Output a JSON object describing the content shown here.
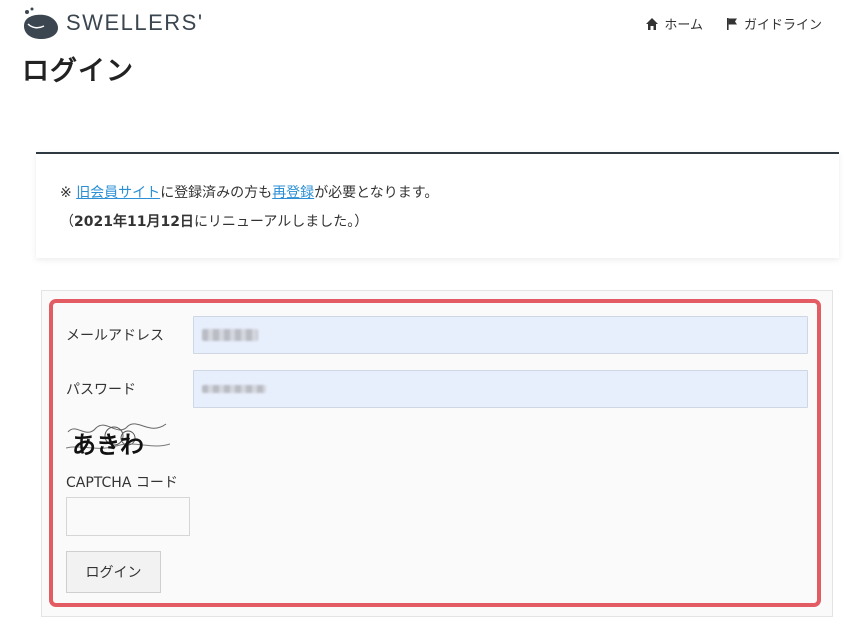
{
  "header": {
    "logo_text": "SWELLERS'",
    "nav": [
      {
        "label": "ホーム",
        "icon": "home-icon"
      },
      {
        "label": "ガイドライン",
        "icon": "flag-icon"
      }
    ]
  },
  "page": {
    "title": "ログイン"
  },
  "notice": {
    "prefix": "※ ",
    "link1": "旧会員サイト",
    "mid1": "に登録済みの方も",
    "link2": "再登録",
    "suffix": "が必要となります。",
    "line2_open": "（",
    "line2_date": "2021年11月12日",
    "line2_rest": "にリニューアルしました。）"
  },
  "form": {
    "email_label": "メールアドレス",
    "password_label": "パスワード",
    "captcha_text": "あきわ",
    "captcha_code_label": "CAPTCHA コード",
    "login_button": "ログイン"
  },
  "colors": {
    "highlight": "#e35b63",
    "link": "#2b8fd6",
    "input_bg": "#e8effc",
    "logo": "#3b4650"
  }
}
